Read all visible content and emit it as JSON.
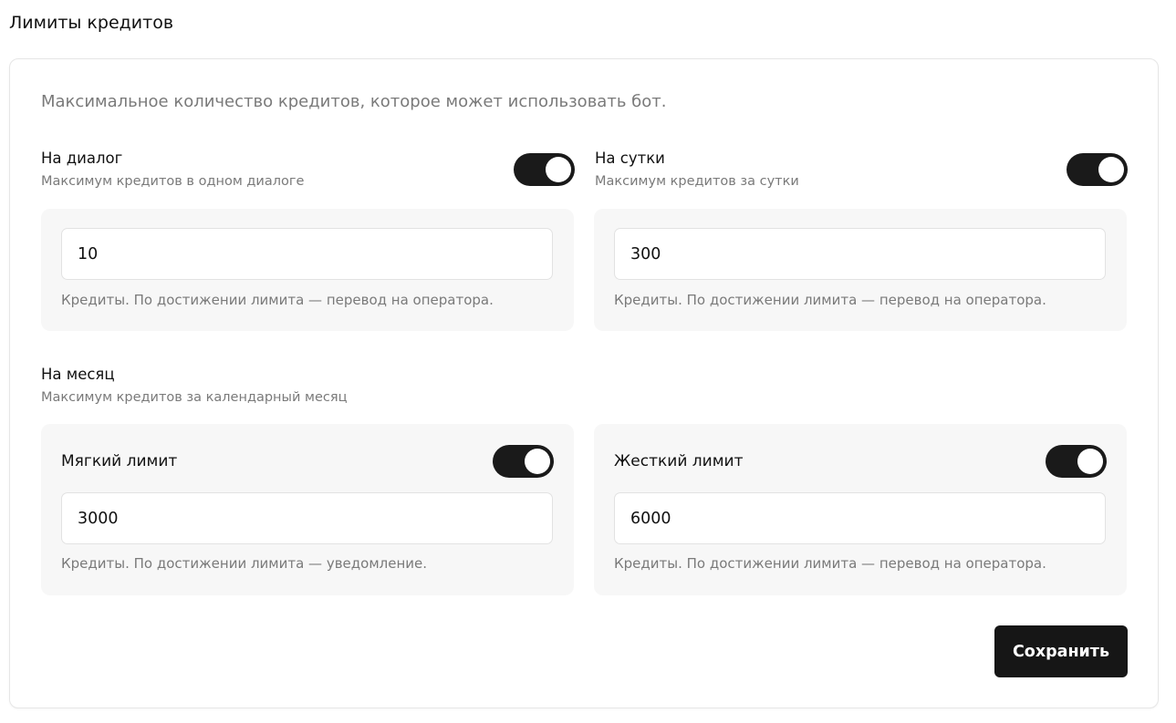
{
  "page": {
    "title": "Лимиты кредитов"
  },
  "card": {
    "description": "Максимальное количество кредитов, которое может использовать бот."
  },
  "dialog": {
    "title": "На диалог",
    "subtitle": "Максимум кредитов в одном диалоге",
    "enabled": true,
    "value": "10",
    "hint": "Кредиты. По достижении лимита — перевод на оператора."
  },
  "day": {
    "title": "На сутки",
    "subtitle": "Максимум кредитов за сутки",
    "enabled": true,
    "value": "300",
    "hint": "Кредиты. По достижении лимита — перевод на оператора."
  },
  "month": {
    "title": "На месяц",
    "subtitle": "Максимум кредитов за календарный месяц",
    "soft": {
      "label": "Мягкий лимит",
      "enabled": true,
      "value": "3000",
      "hint": "Кредиты. По достижении лимита — уведомление."
    },
    "hard": {
      "label": "Жесткий лимит",
      "enabled": true,
      "value": "6000",
      "hint": "Кредиты. По достижении лимита — перевод на оператора."
    }
  },
  "actions": {
    "save_label": "Сохранить"
  },
  "colors": {
    "accent": "#161616",
    "panel": "#f7f7f7",
    "muted_text": "#7a7a7a"
  }
}
